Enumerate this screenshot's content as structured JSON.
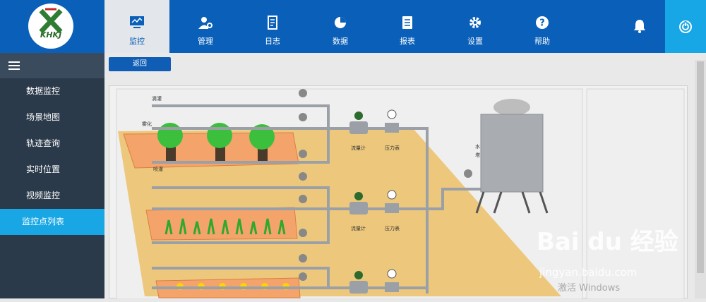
{
  "logo": {
    "text": "KHKJ"
  },
  "nav": [
    {
      "label": "监控",
      "icon": "monitor-icon"
    },
    {
      "label": "管理",
      "icon": "user-gear-icon"
    },
    {
      "label": "日志",
      "icon": "notebook-icon"
    },
    {
      "label": "数据",
      "icon": "pie-chart-icon"
    },
    {
      "label": "报表",
      "icon": "report-icon"
    },
    {
      "label": "设置",
      "icon": "gear-icon"
    },
    {
      "label": "帮助",
      "icon": "help-icon"
    }
  ],
  "header_icons": {
    "bell": "bell-icon",
    "power": "power-icon"
  },
  "sidebar": {
    "menu_icon": "hamburger-icon",
    "items": [
      {
        "label": "数据监控"
      },
      {
        "label": "场景地图"
      },
      {
        "label": "轨迹查询"
      },
      {
        "label": "实时位置"
      },
      {
        "label": "视频监控"
      },
      {
        "label": "监控点列表"
      }
    ]
  },
  "toolbar": {
    "back_label": "返回"
  },
  "diagram": {
    "labels": {
      "drip": "滴灌",
      "mist": "雾化",
      "spray": "喷灌",
      "flowmeter": "流量计",
      "pressure": "压力表",
      "tower_1": "水",
      "tower_2": "塔"
    }
  },
  "watermark": {
    "brand": "Bai du 经验",
    "url": "jingyan.baidu.com",
    "activate": "激活 Windows"
  }
}
